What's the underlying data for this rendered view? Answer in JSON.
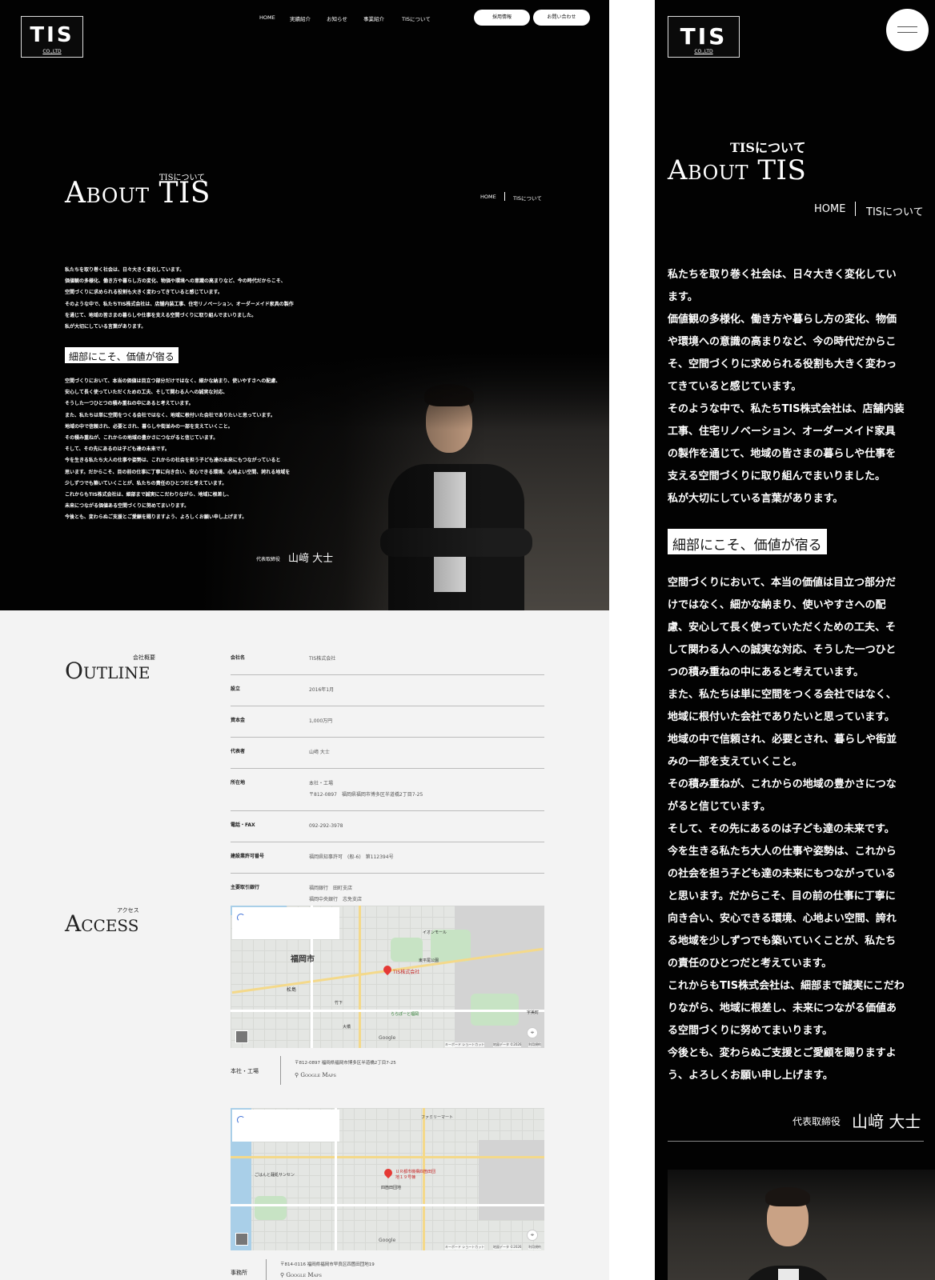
{
  "brand": {
    "logo_main": "TIS",
    "logo_sub": "CO.,LTD"
  },
  "nav": {
    "items": [
      "HOME",
      "実績紹介",
      "お知らせ",
      "事業紹介",
      "TISについて"
    ],
    "recruit_button": "採用情報",
    "contact_button": "お問い合わせ"
  },
  "hero": {
    "title_jp": "TISについて",
    "title_en": "About TIS",
    "breadcrumb": {
      "home": "HOME",
      "current": "TISについて"
    }
  },
  "message": {
    "intro_desktop": [
      "私たちを取り巻く社会は、日々大きく変化しています。",
      "価値観の多様化、働き方や暮らし方の変化、物価や環境への意識の高まりなど、今の時代だからこそ、",
      "空間づくりに求められる役割も大きく変わってきていると感じています。",
      "そのような中で、私たちTIS株式会社は、店舗内装工事、住宅リノベーション、オーダーメイド家具の製作",
      "を通じて、地域の皆さまの暮らしや仕事を支える空間づくりに取り組んでまいりました。",
      "私が大切にしている言葉があります。"
    ],
    "heading": "細部にこそ、価値が宿る",
    "body_desktop": [
      "空間づくりにおいて、本当の価値は目立つ部分だけではなく、細かな納まり、使いやすさへの配慮、",
      "安心して長く使っていただくための工夫、そして関わる人への誠実な対応、",
      "そうした一つひとつの積み重ねの中にあると考えています。",
      "また、私たちは単に空間をつくる会社ではなく、地域に根付いた会社でありたいと思っています。",
      "地域の中で信頼され、必要とされ、暮らしや街並みの一部を支えていくこと。",
      "その積み重ねが、これからの地域の豊かさにつながると信じています。",
      "そして、その先にあるのは子ども達の未来です。",
      "今を生きる私たち大人の仕事や姿勢は、これからの社会を担う子ども達の未来にもつながっていると",
      "思います。だからこそ、目の前の仕事に丁寧に向き合い、安心できる環境、心地よい空間、誇れる地域を",
      "少しずつでも築いていくことが、私たちの責任のひとつだと考えています。",
      "これからもTIS株式会社は、細部まで誠実にこだわりながら、地域に根差し、",
      "未来につながる価値ある空間づくりに努めてまいります。",
      "今後とも、変わらぬご支援とご愛顧を賜りますよう、よろしくお願い申し上げます。"
    ],
    "intro_mobile": [
      "私たちを取り巻く社会は、日々大きく変化してい",
      "ます。",
      "価値観の多様化、働き方や暮らし方の変化、物価",
      "や環境への意識の高まりなど、今の時代だからこ",
      "そ、空間づくりに求められる役割も大きく変わっ",
      "てきていると感じています。",
      "そのような中で、私たちTIS株式会社は、店舗内装",
      "工事、住宅リノベーション、オーダーメイド家具",
      "の製作を通じて、地域の皆さまの暮らしや仕事を",
      "支える空間づくりに取り組んでまいりました。",
      "私が大切にしている言葉があります。"
    ],
    "body_mobile": [
      "空間づくりにおいて、本当の価値は目立つ部分だ",
      "けではなく、細かな納まり、使いやすさへの配",
      "慮、安心して長く使っていただくための工夫、そ",
      "して関わる人への誠実な対応、そうした一つひと",
      "つの積み重ねの中にあると考えています。",
      "また、私たちは単に空間をつくる会社ではなく、",
      "地域に根付いた会社でありたいと思っています。",
      "地域の中で信頼され、必要とされ、暮らしや街並",
      "みの一部を支えていくこと。",
      "その積み重ねが、これからの地域の豊かさにつな",
      "がると信じています。",
      "そして、その先にあるのは子ども達の未来です。",
      "今を生きる私たち大人の仕事や姿勢は、これから",
      "の社会を担う子ども達の未来にもつながっている",
      "と思います。だからこそ、目の前の仕事に丁寧に",
      "向き合い、安心できる環境、心地よい空間、誇れ",
      "る地域を少しずつでも築いていくことが、私たち",
      "の責任のひとつだと考えています。",
      "これからもTIS株式会社は、細部まで誠実にこだわ",
      "りながら、地域に根差し、未来につながる価値あ",
      "る空間づくりに努めてまいります。",
      "今後とも、変わらぬご支援とご愛顧を賜りますよ",
      "う、よろしくお願い申し上げます。"
    ],
    "signature_role": "代表取締役",
    "signature_name": "山﨑 大士"
  },
  "outline": {
    "title_en": "Outline",
    "title_jp": "会社概要",
    "rows": [
      {
        "label": "会社名",
        "value": [
          "TIS株式会社"
        ]
      },
      {
        "label": "設立",
        "value": [
          "2016年1月"
        ]
      },
      {
        "label": "資本金",
        "value": [
          "1,000万円"
        ]
      },
      {
        "label": "代表者",
        "value": [
          "山﨑 大士"
        ]
      },
      {
        "label": "所在地",
        "value": [
          "本社・工場",
          "〒812-0897　福岡県福岡市博多区半道橋2丁目7-25"
        ]
      },
      {
        "label": "電話・FAX",
        "value": [
          "092-292-3978"
        ]
      },
      {
        "label": "建設業許可番号",
        "value": [
          "福岡県知事許可　(般-6)　第112394号"
        ]
      },
      {
        "label": "主要取引銀行",
        "value": [
          "福岡銀行　田町支店",
          "福岡中央銀行　志免支店"
        ]
      }
    ]
  },
  "access": {
    "title_en": "Access",
    "title_jp": "アクセス",
    "locations": [
      {
        "label": "本社・工場",
        "address": "〒812-0897 福岡県福岡市博多区半道橋2丁目7-25",
        "maps_link": "Google Maps",
        "map_labels": [
          "福岡市",
          "TIS株式会社",
          "イオンモール",
          "東平尾公園",
          "松島",
          "竹下",
          "大橋",
          "ららぽーと福岡",
          "宇美町",
          "Google",
          "キーボード ショートカット",
          "地図データ ©2026",
          "利用規約"
        ]
      },
      {
        "label": "事務所",
        "address": "〒814-0116 福岡県福岡市早良区四箇田団地19",
        "maps_link": "Google Maps",
        "map_labels": [
          "ＵＲ都市機構四箇田団地１９号棟",
          "四箇田団地",
          "ファミリーマート",
          "ごはんと麺処サンセン",
          "Google",
          "キーボード ショートカット",
          "地図データ ©2026",
          "利用規約"
        ]
      }
    ]
  },
  "mobile": {
    "menu_icon": "hamburger-icon"
  }
}
